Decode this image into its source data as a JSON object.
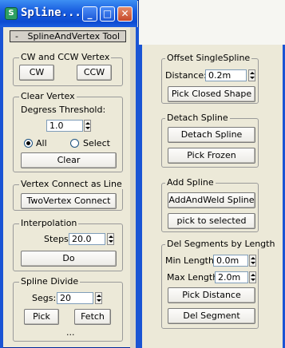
{
  "window": {
    "title": "Spline...",
    "app_icon": "app-logo-icon",
    "minimize": "_",
    "maximize": "□",
    "close": "✕"
  },
  "rollout": {
    "title": "SplineAndVertex Tool",
    "collapse": "-"
  },
  "cw_group": {
    "label": "CW and CCW Vertex",
    "cw": "CW",
    "ccw": "CCW"
  },
  "clear_group": {
    "label": "Clear Vertex",
    "threshold_label": "Degress Threshold:",
    "threshold_value": "1.0",
    "radio_all": "All",
    "radio_select": "Select",
    "selected": "All",
    "clear_btn": "Clear"
  },
  "connect_group": {
    "label": "Vertex Connect as Line",
    "btn": "TwoVertex Connect"
  },
  "interp_group": {
    "label": "Interpolation",
    "steps_label": "Steps:",
    "steps_value": "20.0",
    "do_btn": "Do"
  },
  "divide_group": {
    "label": "Spline Divide",
    "segs_label": "Segs:",
    "segs_value": "20",
    "pick_btn": "Pick",
    "fetch_btn": "Fetch",
    "more": "..."
  },
  "offset_group": {
    "label": "Offset SingleSpline",
    "distance_label": "Distance:",
    "distance_value": "0.2m",
    "pick_btn": "Pick Closed Shape"
  },
  "detach_group": {
    "label": "Detach Spline",
    "detach_btn": "Detach Spline",
    "frozen_btn": "Pick Frozen"
  },
  "add_group": {
    "label": "Add Spline",
    "weld_btn": "AddAndWeld Spline",
    "pick_btn": "pick to selected"
  },
  "del_group": {
    "label": "Del Segments by Length",
    "min_label": "Min Length:",
    "min_value": "0.0m",
    "max_label": "Max Length:",
    "max_value": "2.0m",
    "distance_btn": "Pick Distance",
    "del_btn": "Del Segment"
  }
}
